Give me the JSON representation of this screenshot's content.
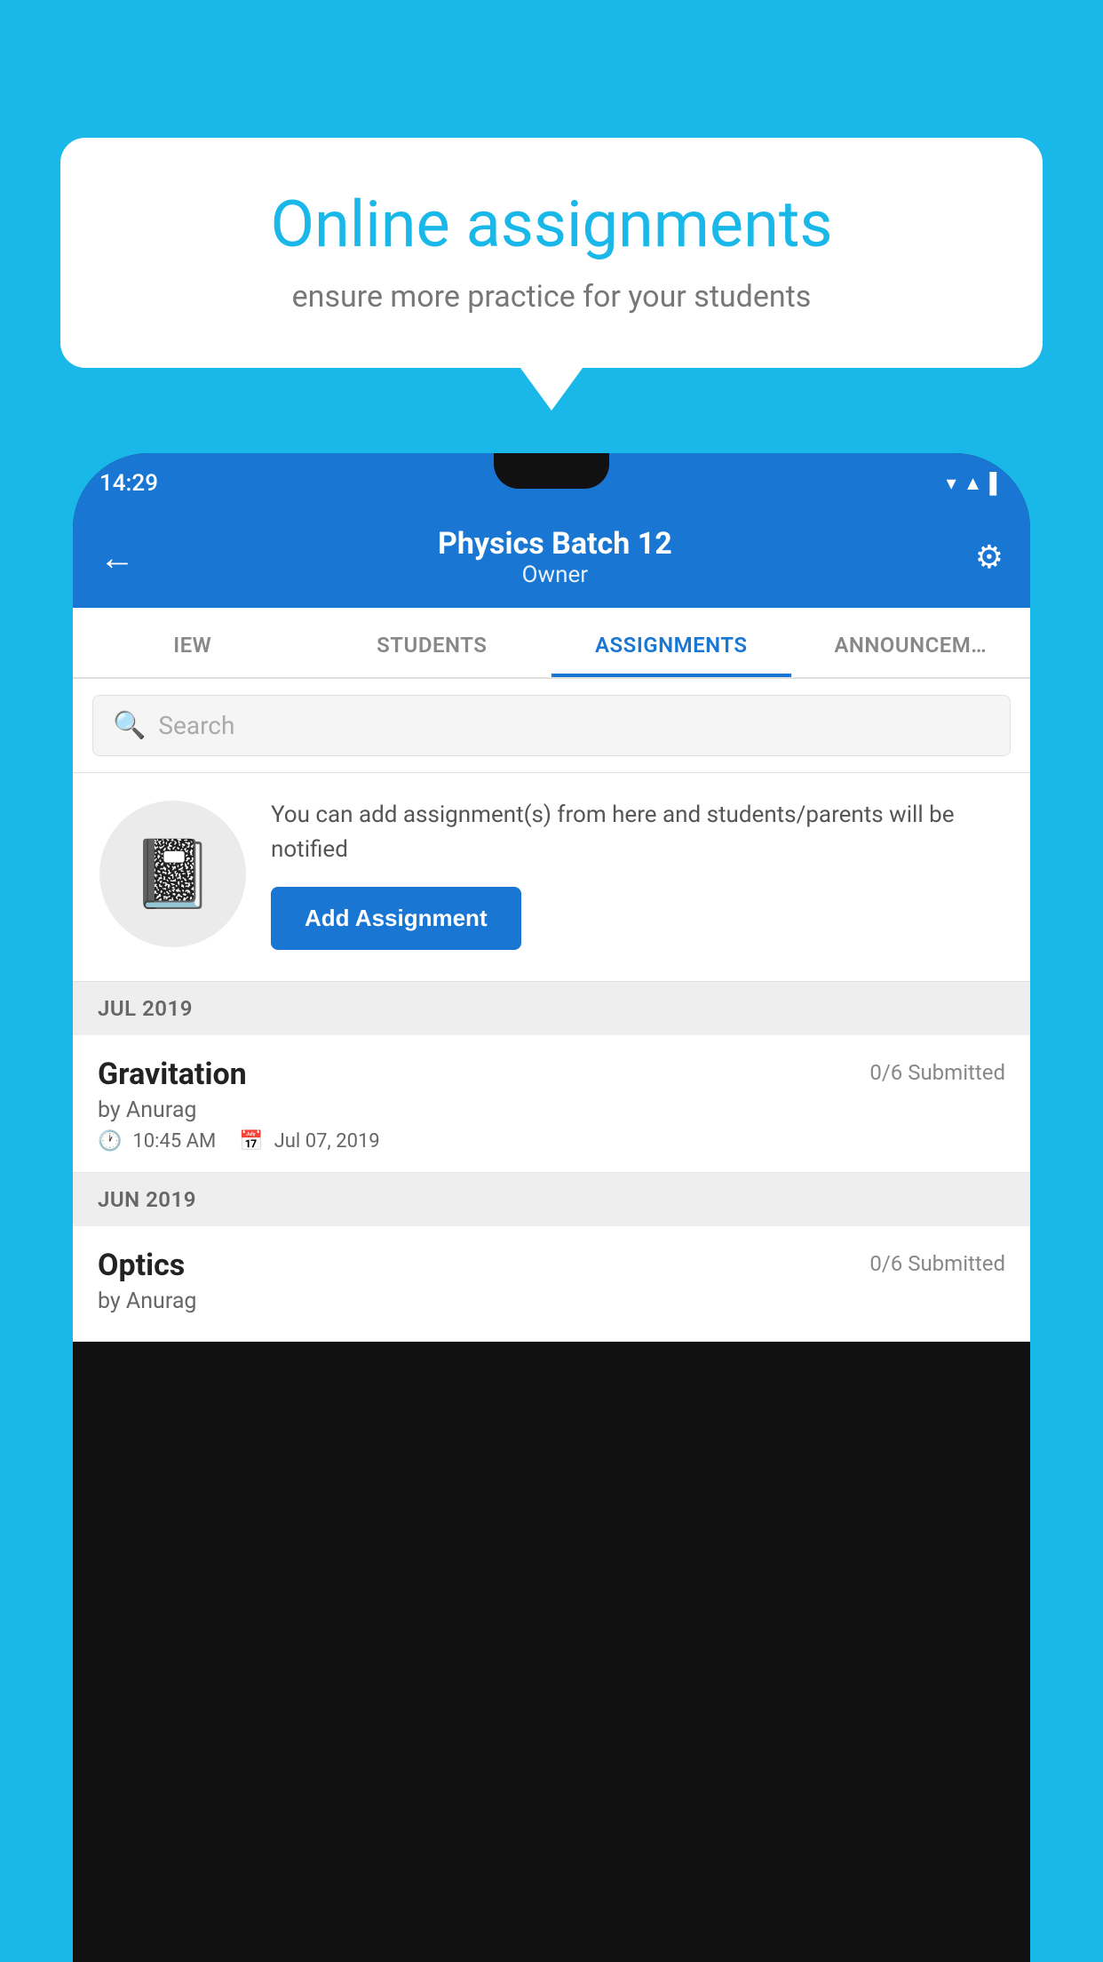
{
  "background_color": "#1ab8e8",
  "speech_bubble": {
    "title": "Online assignments",
    "subtitle": "ensure more practice for your students"
  },
  "phone": {
    "status_bar": {
      "time": "14:29",
      "signal_icon": "▼◀▌"
    },
    "header": {
      "title": "Physics Batch 12",
      "subtitle": "Owner",
      "back_label": "←",
      "settings_label": "⚙"
    },
    "tabs": [
      {
        "label": "IEW",
        "active": false
      },
      {
        "label": "STUDENTS",
        "active": false
      },
      {
        "label": "ASSIGNMENTS",
        "active": true
      },
      {
        "label": "ANNOUNCEM…",
        "active": false
      }
    ],
    "search": {
      "placeholder": "Search"
    },
    "add_assignment_card": {
      "description": "You can add assignment(s) from here and students/parents will be notified",
      "button_label": "Add Assignment"
    },
    "assignment_groups": [
      {
        "month_label": "JUL 2019",
        "assignments": [
          {
            "name": "Gravitation",
            "submitted": "0/6 Submitted",
            "author": "by Anurag",
            "time": "10:45 AM",
            "date": "Jul 07, 2019"
          }
        ]
      },
      {
        "month_label": "JUN 2019",
        "assignments": [
          {
            "name": "Optics",
            "submitted": "0/6 Submitted",
            "author": "by Anurag",
            "time": "",
            "date": ""
          }
        ]
      }
    ]
  }
}
